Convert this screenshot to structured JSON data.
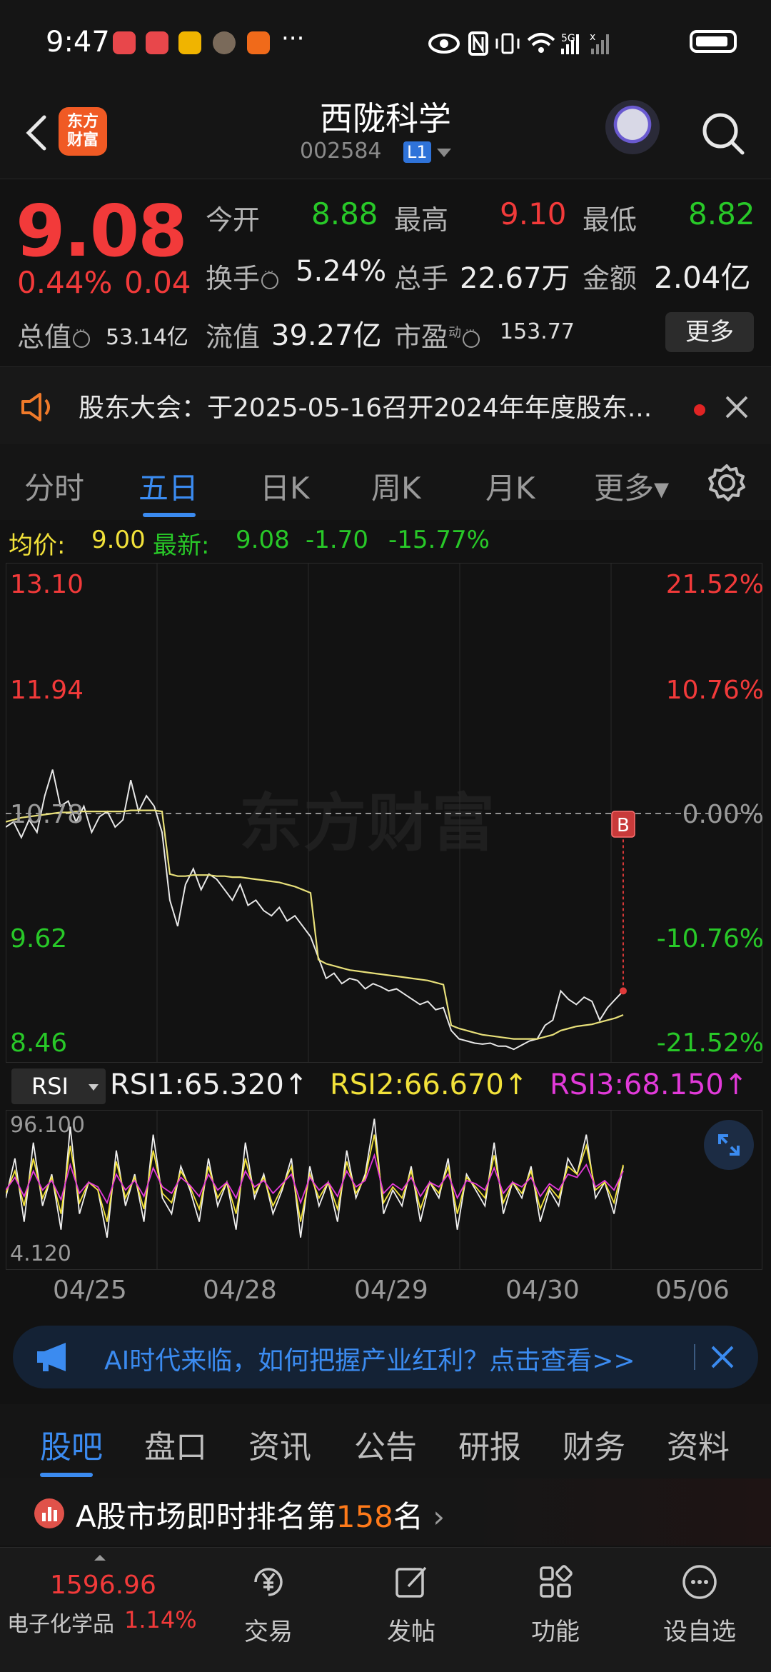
{
  "status_bar": {
    "time": "9:47",
    "more": "···",
    "network": "5G"
  },
  "header": {
    "brand": "东方\n财富",
    "stock_name": "西陇科学",
    "stock_code": "002584",
    "level_badge": "L1"
  },
  "quote": {
    "price": "9.08",
    "change_pct": "0.44%",
    "change_abs": "0.04",
    "open_label": "今开",
    "open_value": "8.88",
    "high_label": "最高",
    "high_value": "9.10",
    "low_label": "最低",
    "low_value": "8.82",
    "turnover_label": "换手",
    "turnover_value": "5.24%",
    "volume_label": "总手",
    "volume_value": "22.67万",
    "amount_label": "金额",
    "amount_value": "2.04亿",
    "mktcap_label": "总值",
    "mktcap_value": "53.14亿",
    "float_label": "流值",
    "float_value": "39.27亿",
    "pe_label": "市盈",
    "pe_sup": "动",
    "pe_value": "153.77",
    "more_button": "更多"
  },
  "notice": {
    "text": "股东大会：于2025-05-16召开2024年年度股东..."
  },
  "chart_tabs": {
    "items": [
      "分时",
      "五日",
      "日K",
      "周K",
      "月K",
      "更多▾"
    ],
    "active": "五日"
  },
  "avg_line": {
    "avg_label": "均价:",
    "avg_value": "9.00",
    "latest_label": "最新:",
    "latest_value": "9.08",
    "change_abs": "-1.70",
    "change_pct": "-15.77%"
  },
  "watermark": "东方财富",
  "marker_label": "B",
  "chart_data": [
    {
      "type": "line",
      "title": "五日",
      "y_left_ticks": [
        "13.10",
        "11.94",
        "10.78",
        "9.62",
        "8.46"
      ],
      "y_right_ticks": [
        "21.52%",
        "10.76%",
        "0.00%",
        "-10.76%",
        "-21.52%"
      ],
      "ylim": [
        8.46,
        13.1
      ],
      "reference_price": 10.78,
      "x_categories": [
        "04/25",
        "04/28",
        "04/29",
        "04/30",
        "05/06"
      ],
      "series": [
        {
          "key": "price",
          "color": "#e8e8e8",
          "values": [
            10.65,
            10.7,
            10.55,
            10.72,
            10.6,
            10.95,
            11.2,
            10.85,
            10.9,
            10.7,
            10.85,
            10.6,
            10.75,
            10.8,
            10.65,
            10.72,
            11.1,
            10.8,
            10.95,
            10.85,
            10.6,
            9.95,
            9.7,
            10.1,
            10.25,
            10.05,
            10.2,
            10.15,
            10.05,
            9.95,
            10.1,
            9.9,
            9.95,
            9.85,
            9.8,
            9.88,
            9.75,
            9.8,
            9.7,
            9.6,
            9.4,
            9.2,
            9.25,
            9.15,
            9.2,
            9.18,
            9.1,
            9.15,
            9.12,
            9.08,
            9.1,
            9.05,
            9.0,
            8.95,
            8.98,
            8.9,
            8.92,
            8.7,
            8.62,
            8.6,
            8.58,
            8.57,
            8.58,
            8.55,
            8.55,
            8.52,
            8.56,
            8.6,
            8.62,
            8.75,
            8.8,
            9.08,
            9.0,
            8.95,
            9.02,
            8.98,
            8.8,
            8.92,
            9.0,
            9.08
          ]
        },
        {
          "key": "average",
          "color": "#e8e07a",
          "values": [
            10.7,
            10.72,
            10.74,
            10.75,
            10.76,
            10.77,
            10.78,
            10.79,
            10.79,
            10.8,
            10.8,
            10.8,
            10.8,
            10.8,
            10.8,
            10.8,
            10.81,
            10.81,
            10.81,
            10.81,
            10.8,
            10.2,
            10.18,
            10.18,
            10.19,
            10.19,
            10.19,
            10.18,
            10.18,
            10.17,
            10.17,
            10.16,
            10.15,
            10.14,
            10.13,
            10.12,
            10.1,
            10.08,
            10.05,
            10.02,
            9.38,
            9.34,
            9.32,
            9.3,
            9.28,
            9.27,
            9.26,
            9.25,
            9.24,
            9.23,
            9.22,
            9.21,
            9.2,
            9.19,
            9.18,
            9.16,
            9.14,
            8.75,
            8.72,
            8.7,
            8.68,
            8.66,
            8.65,
            8.64,
            8.63,
            8.62,
            8.62,
            8.62,
            8.62,
            8.64,
            8.66,
            8.7,
            8.72,
            8.74,
            8.75,
            8.76,
            8.78,
            8.8,
            8.82,
            8.85
          ]
        }
      ]
    },
    {
      "type": "line",
      "title": "RSI",
      "ylim": [
        4.12,
        96.1
      ],
      "y_ticks": [
        "96.100",
        "4.120"
      ],
      "legend": [
        {
          "name": "RSI1",
          "value": "65.320",
          "arrow": "↑",
          "color": "#f0f0f0"
        },
        {
          "name": "RSI2",
          "value": "66.670",
          "arrow": "↑",
          "color": "#f2e23a"
        },
        {
          "name": "RSI3",
          "value": "68.150",
          "arrow": "↑",
          "color": "#e23ad9"
        }
      ],
      "series": [
        {
          "name": "RSI1",
          "color": "#f0f0f0",
          "values": [
            45,
            70,
            30,
            80,
            40,
            60,
            25,
            90,
            35,
            55,
            50,
            20,
            75,
            40,
            60,
            30,
            85,
            45,
            35,
            65,
            50,
            30,
            70,
            40,
            55,
            25,
            80,
            45,
            60,
            35,
            50,
            70,
            20,
            65,
            40,
            55,
            30,
            75,
            45,
            60,
            95,
            35,
            50,
            40,
            65,
            30,
            55,
            45,
            70,
            25,
            60,
            50,
            40,
            80,
            35,
            55,
            45,
            65,
            30,
            50,
            40,
            70,
            60,
            85,
            45,
            55,
            35,
            65
          ]
        },
        {
          "name": "RSI2",
          "color": "#f2e23a",
          "values": [
            48,
            62,
            40,
            70,
            45,
            58,
            35,
            78,
            42,
            55,
            50,
            30,
            68,
            45,
            58,
            38,
            75,
            48,
            42,
            62,
            52,
            38,
            65,
            45,
            55,
            35,
            70,
            48,
            58,
            40,
            52,
            65,
            30,
            60,
            45,
            55,
            38,
            68,
            48,
            58,
            85,
            42,
            52,
            45,
            62,
            38,
            55,
            48,
            65,
            35,
            58,
            52,
            45,
            72,
            42,
            55,
            48,
            62,
            38,
            52,
            45,
            65,
            60,
            78,
            50,
            55,
            42,
            66
          ]
        },
        {
          "name": "RSI3",
          "color": "#e23ad9",
          "values": [
            50,
            58,
            46,
            62,
            50,
            56,
            44,
            66,
            48,
            55,
            52,
            42,
            60,
            50,
            56,
            46,
            64,
            52,
            48,
            58,
            53,
            46,
            60,
            50,
            55,
            45,
            62,
            52,
            56,
            48,
            54,
            60,
            42,
            58,
            50,
            55,
            46,
            62,
            52,
            56,
            72,
            48,
            54,
            50,
            58,
            46,
            55,
            52,
            60,
            45,
            56,
            54,
            50,
            64,
            48,
            55,
            52,
            58,
            46,
            54,
            50,
            60,
            58,
            66,
            52,
            56,
            50,
            62
          ]
        }
      ]
    }
  ],
  "ad": {
    "text": "AI时代来临，如何把握产业红利？点击查看>>"
  },
  "bottom_tabs": {
    "items": [
      "股吧",
      "盘口",
      "资讯",
      "公告",
      "研报",
      "财务",
      "资料"
    ],
    "active": "股吧"
  },
  "rank": {
    "prefix": "A股市场即时排名第",
    "number": "158",
    "suffix": "名"
  },
  "bottom_nav": {
    "index_value": "1596.96",
    "index_name": "电子化学品",
    "index_pct": "1.14%",
    "items": [
      "交易",
      "发帖",
      "功能",
      "设自选"
    ]
  },
  "colors": {
    "up": "#f23a3a",
    "down": "#28c828",
    "accent": "#3b8bf0"
  }
}
